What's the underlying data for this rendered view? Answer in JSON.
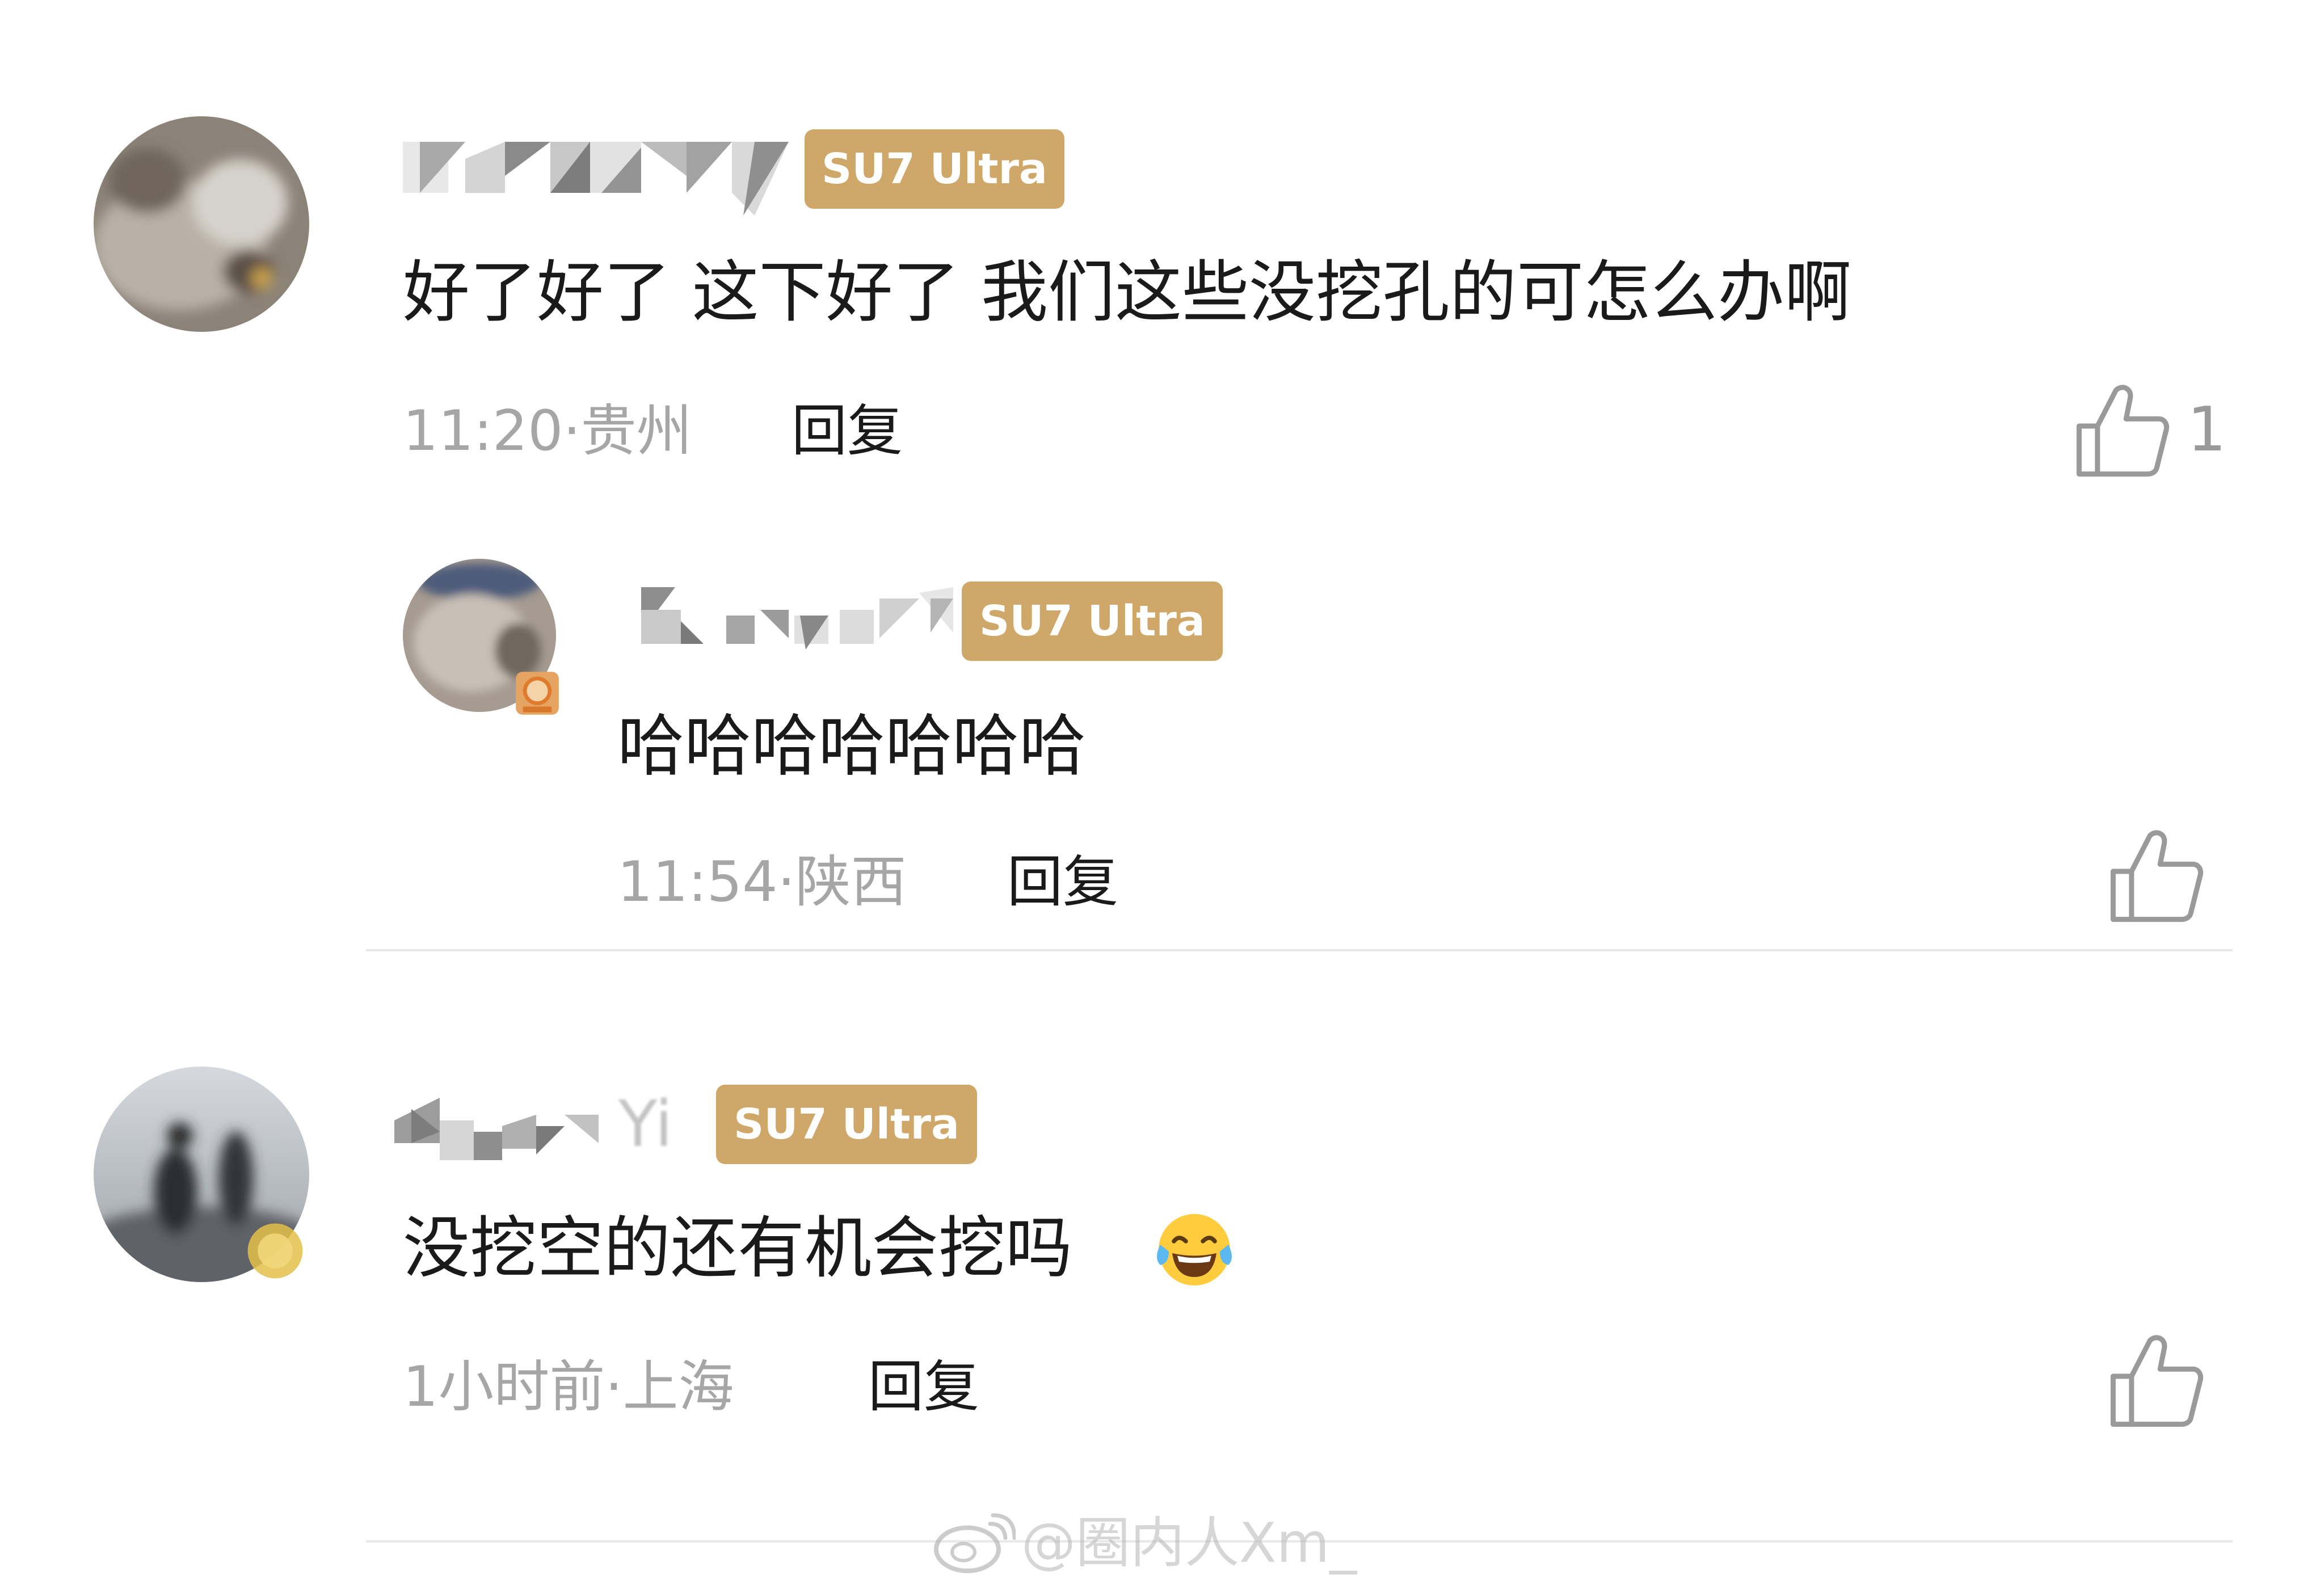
{
  "comments": [
    {
      "username": "",
      "tag": "SU7 Ultra",
      "text": "好了好了 这下好了 我们这些没挖孔的可怎么办啊",
      "time": "11:20",
      "location": "贵州",
      "reply_label": "回复",
      "likes": "1",
      "avatar_icon": "cat-avatar"
    },
    {
      "username": "",
      "tag": "SU7 Ultra",
      "text": "哈哈哈哈哈哈哈",
      "time": "11:54",
      "location": "陕西",
      "reply_label": "回复",
      "likes": "",
      "avatar_icon": "cat-avatar"
    },
    {
      "username": "Yi",
      "tag": "SU7 Ultra",
      "text": "没挖空的还有机会挖吗",
      "time": "1小时前",
      "location": "上海",
      "reply_label": "回复",
      "likes": "",
      "avatar_icon": "photo-avatar",
      "emoji": "tears-of-joy-emoji"
    }
  ],
  "separator": "·",
  "watermark": {
    "text": "@圈内人Xm_",
    "icon": "weibo-icon"
  },
  "colors": {
    "tag_gold": "#cfa869",
    "text": "#1a1a1a",
    "meta_gray": "#a6a6a6",
    "like_gray": "#9a9a9a"
  }
}
